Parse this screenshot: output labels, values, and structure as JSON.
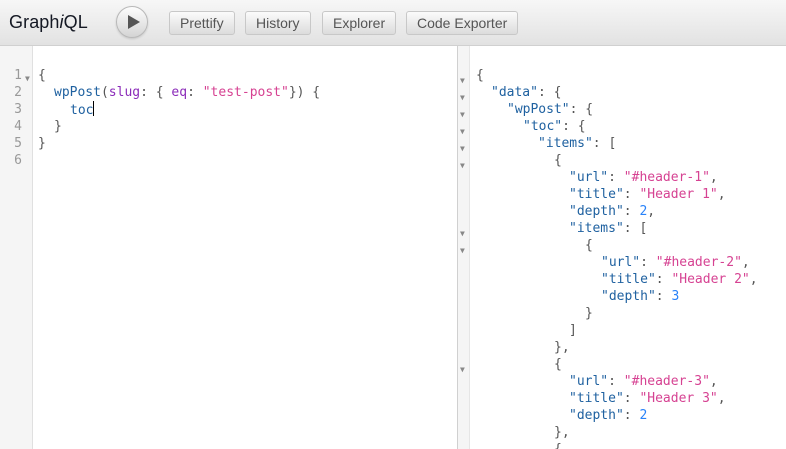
{
  "app": {
    "title_prefix": "Graph",
    "title_em": "i",
    "title_suffix": "QL"
  },
  "toolbar": {
    "prettify": "Prettify",
    "history": "History",
    "explorer": "Explorer",
    "code_exporter": "Code Exporter"
  },
  "editor": {
    "line_numbers": [
      "1",
      "2",
      "3",
      "4",
      "5",
      "6"
    ],
    "l1": "{",
    "l2_field": "wpPost",
    "l2_open": "(",
    "l2_arg": "slug",
    "l2_colon": ": { ",
    "l2_eq": "eq",
    "l2_colon2": ": ",
    "l2_str": "\"test-post\"",
    "l2_close": "}) {",
    "l3_field": "toc",
    "l4": "}",
    "l5": "}"
  },
  "result": {
    "lines": [
      "{",
      "\"data\"",
      ": {",
      "\"wpPost\"",
      ": {",
      "\"toc\"",
      ": {",
      "\"items\"",
      ": [",
      "{",
      "\"url\"",
      "\"#header-1\"",
      "\"title\"",
      "\"Header 1\"",
      "\"depth\"",
      "2",
      "\"items\"",
      ": [",
      "{",
      "\"url\"",
      "\"#header-2\"",
      "\"title\"",
      "\"Header 2\"",
      "\"depth\"",
      "3",
      "}",
      "]",
      "},",
      "{",
      "\"url\"",
      "\"#header-3\"",
      "\"title\"",
      "\"Header 3\"",
      "\"depth\"",
      "2",
      "},",
      "{"
    ],
    "k_data": "\"data\"",
    "k_wppost": "\"wpPost\"",
    "k_toc": "\"toc\"",
    "k_items": "\"items\"",
    "k_url": "\"url\"",
    "k_title": "\"title\"",
    "k_depth": "\"depth\"",
    "v_url1": "\"#header-1\"",
    "v_title1": "\"Header 1\"",
    "v_depth1": "2",
    "v_url2": "\"#header-2\"",
    "v_title2": "\"Header 2\"",
    "v_depth2": "3",
    "v_url3": "\"#header-3\"",
    "v_title3": "\"Header 3\"",
    "v_depth3": "2"
  },
  "icons": {
    "play": "play-icon",
    "fold": "fold-arrow-icon"
  }
}
